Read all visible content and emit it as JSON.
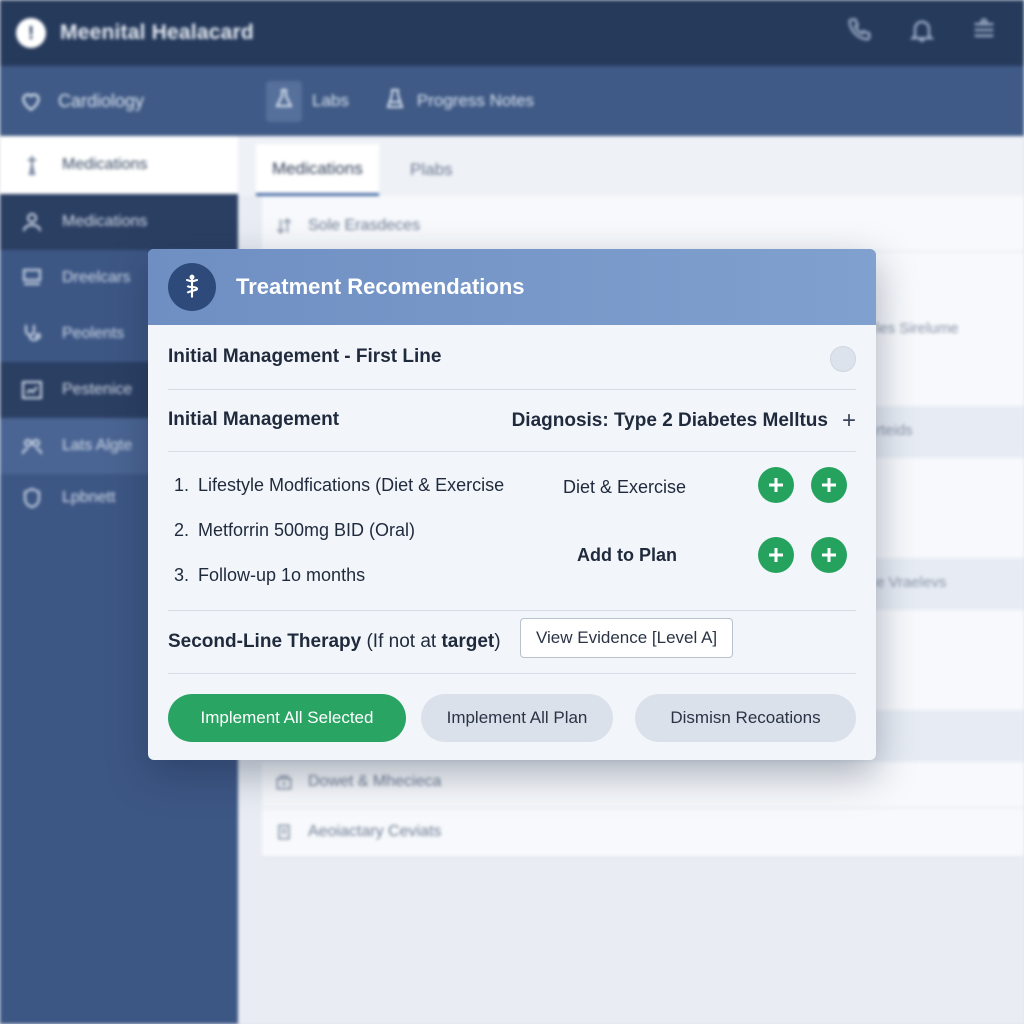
{
  "app": {
    "title": "Meenital Healacard",
    "logo_glyph": "!"
  },
  "subnav": {
    "department": "Cardiology",
    "tabs": [
      {
        "label": "Labs"
      },
      {
        "label": "Progress Notes"
      }
    ]
  },
  "sidebar": {
    "items": [
      {
        "label": "Medications"
      },
      {
        "label": "Medications"
      },
      {
        "label": "Dreelcars"
      },
      {
        "label": "Peolents"
      },
      {
        "label": "Pestenice"
      },
      {
        "label": "Lats Algte"
      },
      {
        "label": "Lpbnett"
      }
    ]
  },
  "content": {
    "tabs": [
      {
        "label": "Medications"
      },
      {
        "label": "Plabs"
      }
    ],
    "rows": [
      "Sole Erasdeces",
      "Dowet & Mhecieca",
      "Aeoiactary Ceviats"
    ],
    "right_fragments": [
      "les Sirelume",
      "rteids",
      "e Vraelevs"
    ]
  },
  "modal": {
    "title": "Treatment Recomendations",
    "first_line_title": "Initial Management - First Line",
    "initial_management_label": "Initial Management",
    "diagnosis": "Diagnosis: Type 2 Diabetes Melltus",
    "diagnosis_plus": "+",
    "items": [
      {
        "num": "1.",
        "text": "Lifestyle Modfications (Diet & Exercise"
      },
      {
        "num": "2.",
        "text": "Metforrin 500mg BID (Oral)"
      },
      {
        "num": "3.",
        "text": "Follow-up 1o months"
      }
    ],
    "diet_label": "Diet & Exercise",
    "add_plan_label": "Add to Plan",
    "second_line_bold": "Second-Line Therapy",
    "second_line_mid": " (If not at ",
    "second_line_bold2": "target",
    "second_line_end": ")",
    "view_evidence": "View Evidence [Level A]",
    "buttons": {
      "implement_selected": "Implement All Selected",
      "implement_plan": "Implement All Plan",
      "dismiss": "Dismisn Recoations"
    }
  },
  "colors": {
    "topbar": "#263a5c",
    "sidebar": "#3d5785",
    "modal_header": "#7595c8",
    "success_green": "#2aa463"
  }
}
